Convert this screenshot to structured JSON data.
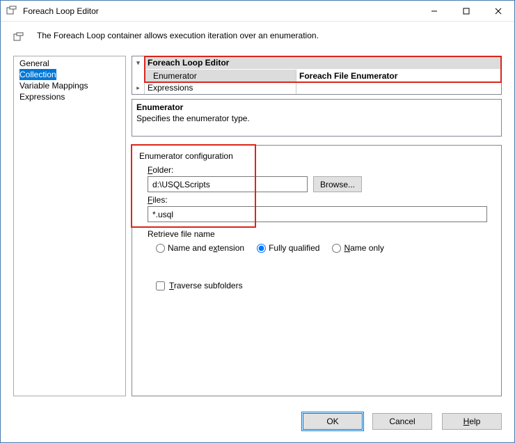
{
  "window": {
    "title": "Foreach Loop Editor"
  },
  "header": {
    "text": "The Foreach Loop container allows execution iteration over an enumeration."
  },
  "nav": {
    "items": [
      {
        "label": "General"
      },
      {
        "label": "Collection"
      },
      {
        "label": "Variable Mappings"
      },
      {
        "label": "Expressions"
      }
    ]
  },
  "grid": {
    "category": "Foreach Loop Editor",
    "enum_label": "Enumerator",
    "enum_value": "Foreach File Enumerator",
    "expr_label": "Expressions"
  },
  "desc": {
    "title": "Enumerator",
    "text": "Specifies the enumerator type."
  },
  "config": {
    "group_label": "Enumerator configuration",
    "folder_label_pre": "F",
    "folder_label_rest": "older:",
    "folder_value": "d:\\USQLScripts",
    "browse_label": "Browse...",
    "files_label_pre": "F",
    "files_label_rest": "iles:",
    "files_value": "*.usql",
    "retrieve_label": "Retrieve file name",
    "opt1_pre": "Name and e",
    "opt1_u": "x",
    "opt1_post": "tension",
    "opt2_label": "Fully qualified",
    "opt3_u": "N",
    "opt3_post": "ame only",
    "traverse_u": "T",
    "traverse_post": "raverse subfolders"
  },
  "buttons": {
    "ok": "OK",
    "cancel": "Cancel",
    "help_u": "H",
    "help_post": "elp"
  }
}
